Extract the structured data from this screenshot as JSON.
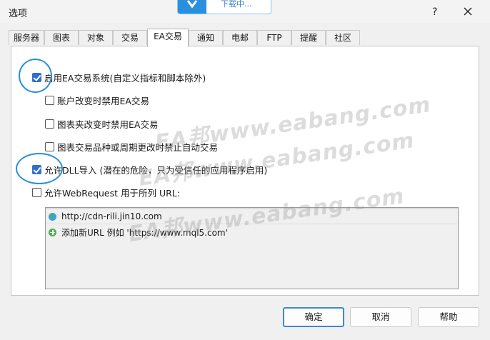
{
  "window": {
    "title": "选项"
  },
  "download_overlay": {
    "text": "下载中..."
  },
  "tabs": [
    {
      "label": "服务器"
    },
    {
      "label": "图表"
    },
    {
      "label": "对象"
    },
    {
      "label": "交易"
    },
    {
      "label": "EA交易"
    },
    {
      "label": "通知"
    },
    {
      "label": "电邮"
    },
    {
      "label": "FTP"
    },
    {
      "label": "提醒"
    },
    {
      "label": "社区"
    }
  ],
  "active_tab": "EA交易",
  "options": {
    "enable_ea": {
      "label": "启用EA交易系统(自定义指标和脚本除外)",
      "checked": true
    },
    "disable_on_account_change": {
      "label": "账户改变时禁用EA交易",
      "checked": false
    },
    "disable_on_profile_change": {
      "label": "图表夹改变时禁用EA交易",
      "checked": false
    },
    "disable_on_symbol_change": {
      "label": "图表交易品种或周期更改时禁止自动交易",
      "checked": false
    },
    "allow_dll": {
      "label": "允许DLL导入 (潜在的危险，只为受信任的应用程序启用)",
      "checked": true
    },
    "allow_webrequest": {
      "label": "允许WebRequest 用于所列 URL:",
      "checked": false
    }
  },
  "url_list": [
    {
      "url": "http://cdn-rili.jin10.com",
      "icon": "globe-icon"
    },
    {
      "url": "添加新URL 例如 'https://www.mql5.com'",
      "icon": "add-icon"
    }
  ],
  "buttons": {
    "ok": "确定",
    "cancel": "取消",
    "help": "帮助"
  },
  "watermark": "EA邦www.eabang.com",
  "colors": {
    "accent": "#2e6fd3",
    "highlight_circle": "#2a8fdc"
  }
}
